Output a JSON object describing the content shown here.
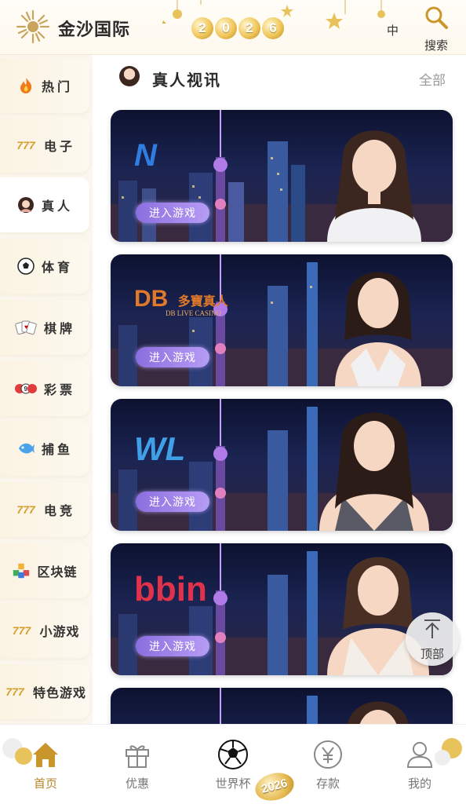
{
  "header": {
    "brand": "金沙国际",
    "year_digits": [
      "2",
      "0",
      "2",
      "6"
    ],
    "lang": "中",
    "search_label": "搜索"
  },
  "sidebar": {
    "items": [
      {
        "label": "热门",
        "icon": "fire-icon",
        "active": false
      },
      {
        "label": "电子",
        "icon": "slot-777-icon",
        "active": false
      },
      {
        "label": "真人",
        "icon": "live-dealer-icon",
        "active": true
      },
      {
        "label": "体育",
        "icon": "soccer-ball-icon",
        "active": false
      },
      {
        "label": "棋牌",
        "icon": "cards-icon",
        "active": false
      },
      {
        "label": "彩票",
        "icon": "lottery-balls-icon",
        "active": false
      },
      {
        "label": "捕鱼",
        "icon": "fish-icon",
        "active": false
      },
      {
        "label": "电竞",
        "icon": "slot-777-icon",
        "active": false
      },
      {
        "label": "区块链",
        "icon": "blocks-icon",
        "active": false
      },
      {
        "label": "小游戏",
        "icon": "slot-777-icon",
        "active": false
      },
      {
        "label": "特色游戏",
        "icon": "slot-777-icon",
        "active": false
      }
    ]
  },
  "section": {
    "title": "真人视讯",
    "all_label": "全部"
  },
  "cards": [
    {
      "provider": "N",
      "provider_color": "#2f7de0",
      "button_label": "进入游戏"
    },
    {
      "provider": "DB",
      "provider_sub": "多寶真人",
      "provider_sub2": "DB LIVE CASINO",
      "provider_color": "#e07a2a",
      "button_label": "进入游戏"
    },
    {
      "provider": "WL",
      "provider_color": "#3fa0e8",
      "button_label": "进入游戏"
    },
    {
      "provider": "bbin",
      "provider_color": "#e0324a",
      "button_label": "进入游戏"
    }
  ],
  "top_button": {
    "label": "顶部"
  },
  "bottom_nav": {
    "items": [
      {
        "label": "首页",
        "icon": "home-icon",
        "active": true
      },
      {
        "label": "优惠",
        "icon": "gift-icon",
        "active": false
      },
      {
        "label": "世界杯",
        "icon": "soccer-ball-icon",
        "active": false
      },
      {
        "label": "存款",
        "icon": "yen-coin-icon",
        "active": false
      },
      {
        "label": "我的",
        "icon": "user-icon",
        "active": false
      }
    ],
    "badge_year": "2026"
  },
  "colors": {
    "accent_gold": "#b8862b",
    "button_purple": "#9b7fe8"
  }
}
